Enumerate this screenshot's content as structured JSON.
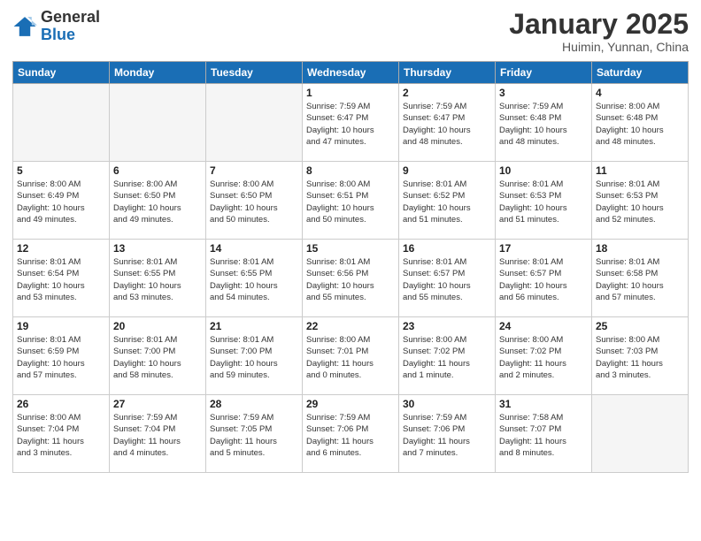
{
  "header": {
    "logo_general": "General",
    "logo_blue": "Blue",
    "month_title": "January 2025",
    "location": "Huimin, Yunnan, China"
  },
  "weekdays": [
    "Sunday",
    "Monday",
    "Tuesday",
    "Wednesday",
    "Thursday",
    "Friday",
    "Saturday"
  ],
  "weeks": [
    [
      {
        "day": "",
        "info": ""
      },
      {
        "day": "",
        "info": ""
      },
      {
        "day": "",
        "info": ""
      },
      {
        "day": "1",
        "info": "Sunrise: 7:59 AM\nSunset: 6:47 PM\nDaylight: 10 hours\nand 47 minutes."
      },
      {
        "day": "2",
        "info": "Sunrise: 7:59 AM\nSunset: 6:47 PM\nDaylight: 10 hours\nand 48 minutes."
      },
      {
        "day": "3",
        "info": "Sunrise: 7:59 AM\nSunset: 6:48 PM\nDaylight: 10 hours\nand 48 minutes."
      },
      {
        "day": "4",
        "info": "Sunrise: 8:00 AM\nSunset: 6:48 PM\nDaylight: 10 hours\nand 48 minutes."
      }
    ],
    [
      {
        "day": "5",
        "info": "Sunrise: 8:00 AM\nSunset: 6:49 PM\nDaylight: 10 hours\nand 49 minutes."
      },
      {
        "day": "6",
        "info": "Sunrise: 8:00 AM\nSunset: 6:50 PM\nDaylight: 10 hours\nand 49 minutes."
      },
      {
        "day": "7",
        "info": "Sunrise: 8:00 AM\nSunset: 6:50 PM\nDaylight: 10 hours\nand 50 minutes."
      },
      {
        "day": "8",
        "info": "Sunrise: 8:00 AM\nSunset: 6:51 PM\nDaylight: 10 hours\nand 50 minutes."
      },
      {
        "day": "9",
        "info": "Sunrise: 8:01 AM\nSunset: 6:52 PM\nDaylight: 10 hours\nand 51 minutes."
      },
      {
        "day": "10",
        "info": "Sunrise: 8:01 AM\nSunset: 6:53 PM\nDaylight: 10 hours\nand 51 minutes."
      },
      {
        "day": "11",
        "info": "Sunrise: 8:01 AM\nSunset: 6:53 PM\nDaylight: 10 hours\nand 52 minutes."
      }
    ],
    [
      {
        "day": "12",
        "info": "Sunrise: 8:01 AM\nSunset: 6:54 PM\nDaylight: 10 hours\nand 53 minutes."
      },
      {
        "day": "13",
        "info": "Sunrise: 8:01 AM\nSunset: 6:55 PM\nDaylight: 10 hours\nand 53 minutes."
      },
      {
        "day": "14",
        "info": "Sunrise: 8:01 AM\nSunset: 6:55 PM\nDaylight: 10 hours\nand 54 minutes."
      },
      {
        "day": "15",
        "info": "Sunrise: 8:01 AM\nSunset: 6:56 PM\nDaylight: 10 hours\nand 55 minutes."
      },
      {
        "day": "16",
        "info": "Sunrise: 8:01 AM\nSunset: 6:57 PM\nDaylight: 10 hours\nand 55 minutes."
      },
      {
        "day": "17",
        "info": "Sunrise: 8:01 AM\nSunset: 6:57 PM\nDaylight: 10 hours\nand 56 minutes."
      },
      {
        "day": "18",
        "info": "Sunrise: 8:01 AM\nSunset: 6:58 PM\nDaylight: 10 hours\nand 57 minutes."
      }
    ],
    [
      {
        "day": "19",
        "info": "Sunrise: 8:01 AM\nSunset: 6:59 PM\nDaylight: 10 hours\nand 57 minutes."
      },
      {
        "day": "20",
        "info": "Sunrise: 8:01 AM\nSunset: 7:00 PM\nDaylight: 10 hours\nand 58 minutes."
      },
      {
        "day": "21",
        "info": "Sunrise: 8:01 AM\nSunset: 7:00 PM\nDaylight: 10 hours\nand 59 minutes."
      },
      {
        "day": "22",
        "info": "Sunrise: 8:00 AM\nSunset: 7:01 PM\nDaylight: 11 hours\nand 0 minutes."
      },
      {
        "day": "23",
        "info": "Sunrise: 8:00 AM\nSunset: 7:02 PM\nDaylight: 11 hours\nand 1 minute."
      },
      {
        "day": "24",
        "info": "Sunrise: 8:00 AM\nSunset: 7:02 PM\nDaylight: 11 hours\nand 2 minutes."
      },
      {
        "day": "25",
        "info": "Sunrise: 8:00 AM\nSunset: 7:03 PM\nDaylight: 11 hours\nand 3 minutes."
      }
    ],
    [
      {
        "day": "26",
        "info": "Sunrise: 8:00 AM\nSunset: 7:04 PM\nDaylight: 11 hours\nand 3 minutes."
      },
      {
        "day": "27",
        "info": "Sunrise: 7:59 AM\nSunset: 7:04 PM\nDaylight: 11 hours\nand 4 minutes."
      },
      {
        "day": "28",
        "info": "Sunrise: 7:59 AM\nSunset: 7:05 PM\nDaylight: 11 hours\nand 5 minutes."
      },
      {
        "day": "29",
        "info": "Sunrise: 7:59 AM\nSunset: 7:06 PM\nDaylight: 11 hours\nand 6 minutes."
      },
      {
        "day": "30",
        "info": "Sunrise: 7:59 AM\nSunset: 7:06 PM\nDaylight: 11 hours\nand 7 minutes."
      },
      {
        "day": "31",
        "info": "Sunrise: 7:58 AM\nSunset: 7:07 PM\nDaylight: 11 hours\nand 8 minutes."
      },
      {
        "day": "",
        "info": ""
      }
    ]
  ]
}
